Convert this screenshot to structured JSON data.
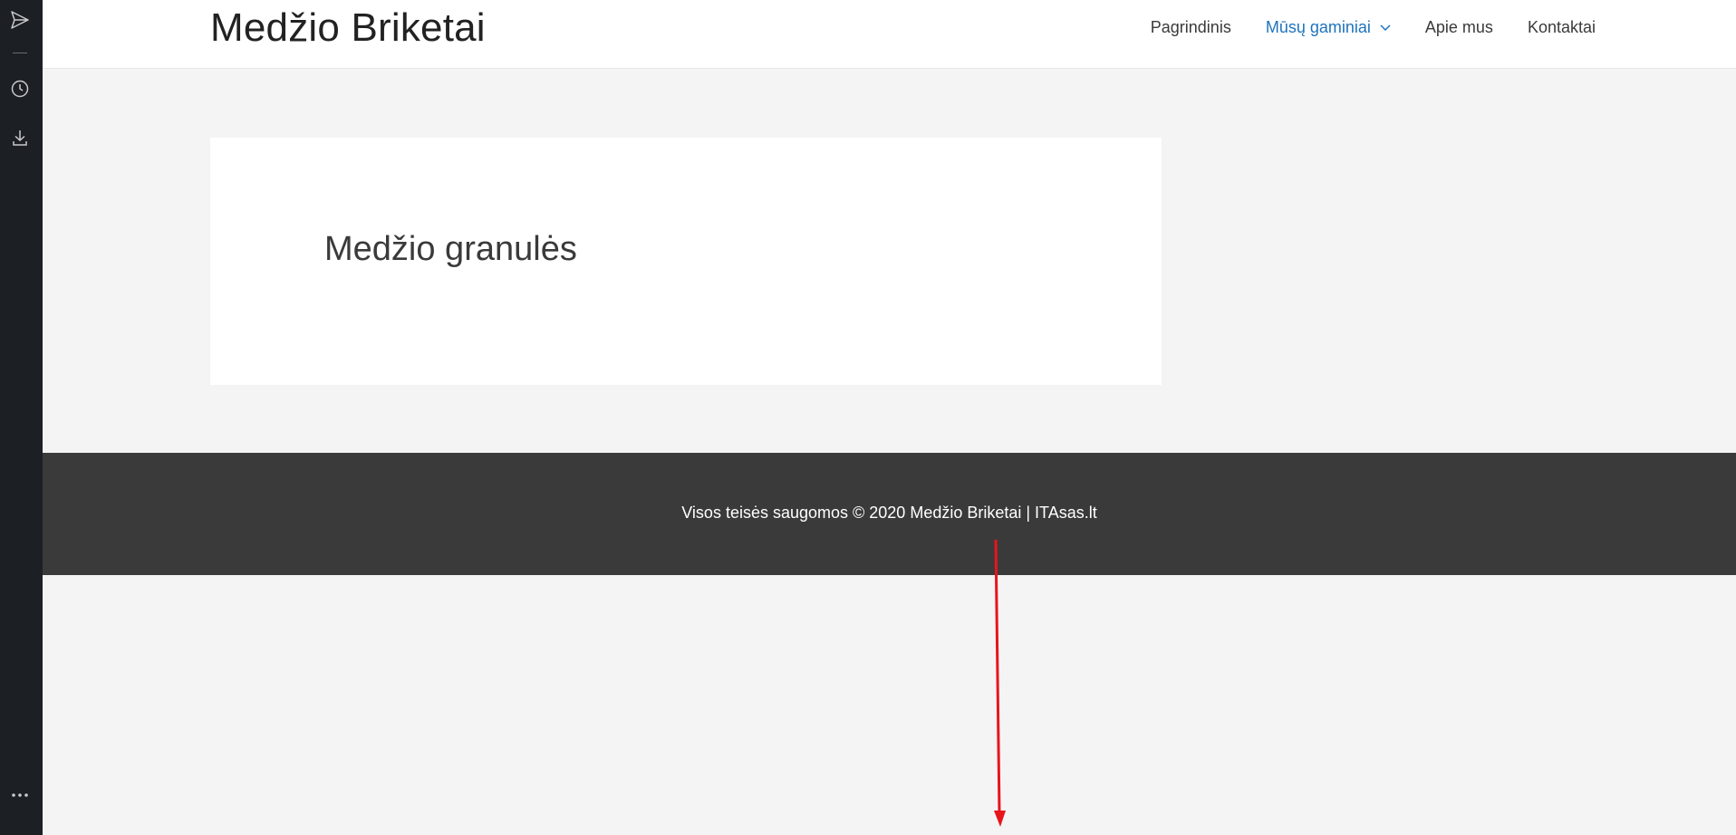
{
  "sidebar": {
    "icons": [
      "send-icon",
      "history-icon",
      "download-icon",
      "more-icon"
    ]
  },
  "header": {
    "site_title": "Medžio Briketai",
    "nav": [
      {
        "label": "Pagrindinis"
      },
      {
        "label": "Mūsų gaminiai",
        "active": true
      },
      {
        "label": "Apie mus"
      },
      {
        "label": "Kontaktai"
      }
    ]
  },
  "main": {
    "card_title": "Medžio granulės"
  },
  "footer": {
    "copyright": "Visos teisės saugomos © 2020 Medžio Briketai | ",
    "link_label": "ITAsas.lt"
  },
  "colors": {
    "accent": "#1e73be",
    "footer_bg": "#3a3a3a",
    "annotation_arrow": "#e8141c"
  }
}
